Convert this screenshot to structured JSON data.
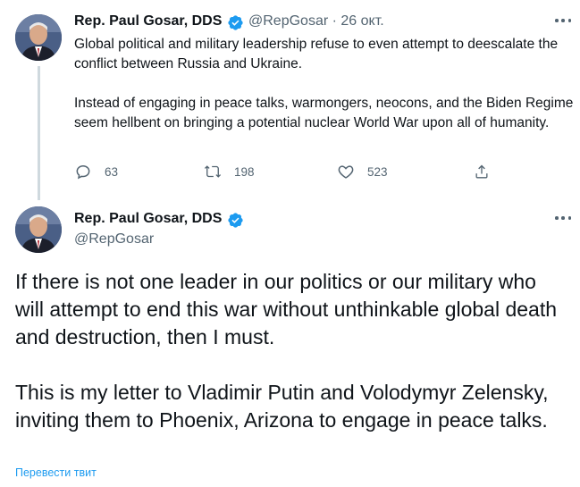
{
  "tweet1": {
    "author_name": "Rep. Paul Gosar, DDS",
    "handle": "@RepGosar",
    "separator": "·",
    "date": "26 окт.",
    "paragraphs": [
      "Global political and military leadership refuse to even attempt to deescalate the conflict between Russia and Ukraine.",
      "Instead of engaging in peace talks, warmongers, neocons, and the Biden Regime seem hellbent on bringing a potential nuclear World War upon all of humanity."
    ],
    "replies": "63",
    "retweets": "198",
    "likes": "523"
  },
  "tweet2": {
    "author_name": "Rep. Paul Gosar, DDS",
    "handle": "@RepGosar",
    "paragraphs": [
      "If there is not one leader in our politics or our military who will attempt to end this war without unthinkable global death and destruction, then I must.",
      "This is my letter to Vladimir Putin and Volodymyr Zelensky, inviting them to Phoenix, Arizona to engage in peace talks."
    ],
    "translate_label": "Перевести твит"
  },
  "colors": {
    "accent": "#1d9bf0",
    "text": "#0f1419",
    "secondary": "#536471",
    "thread_line": "#cfd9de"
  },
  "icons": [
    "verified-badge-icon",
    "more-icon",
    "reply-icon",
    "retweet-icon",
    "like-icon",
    "share-icon"
  ]
}
